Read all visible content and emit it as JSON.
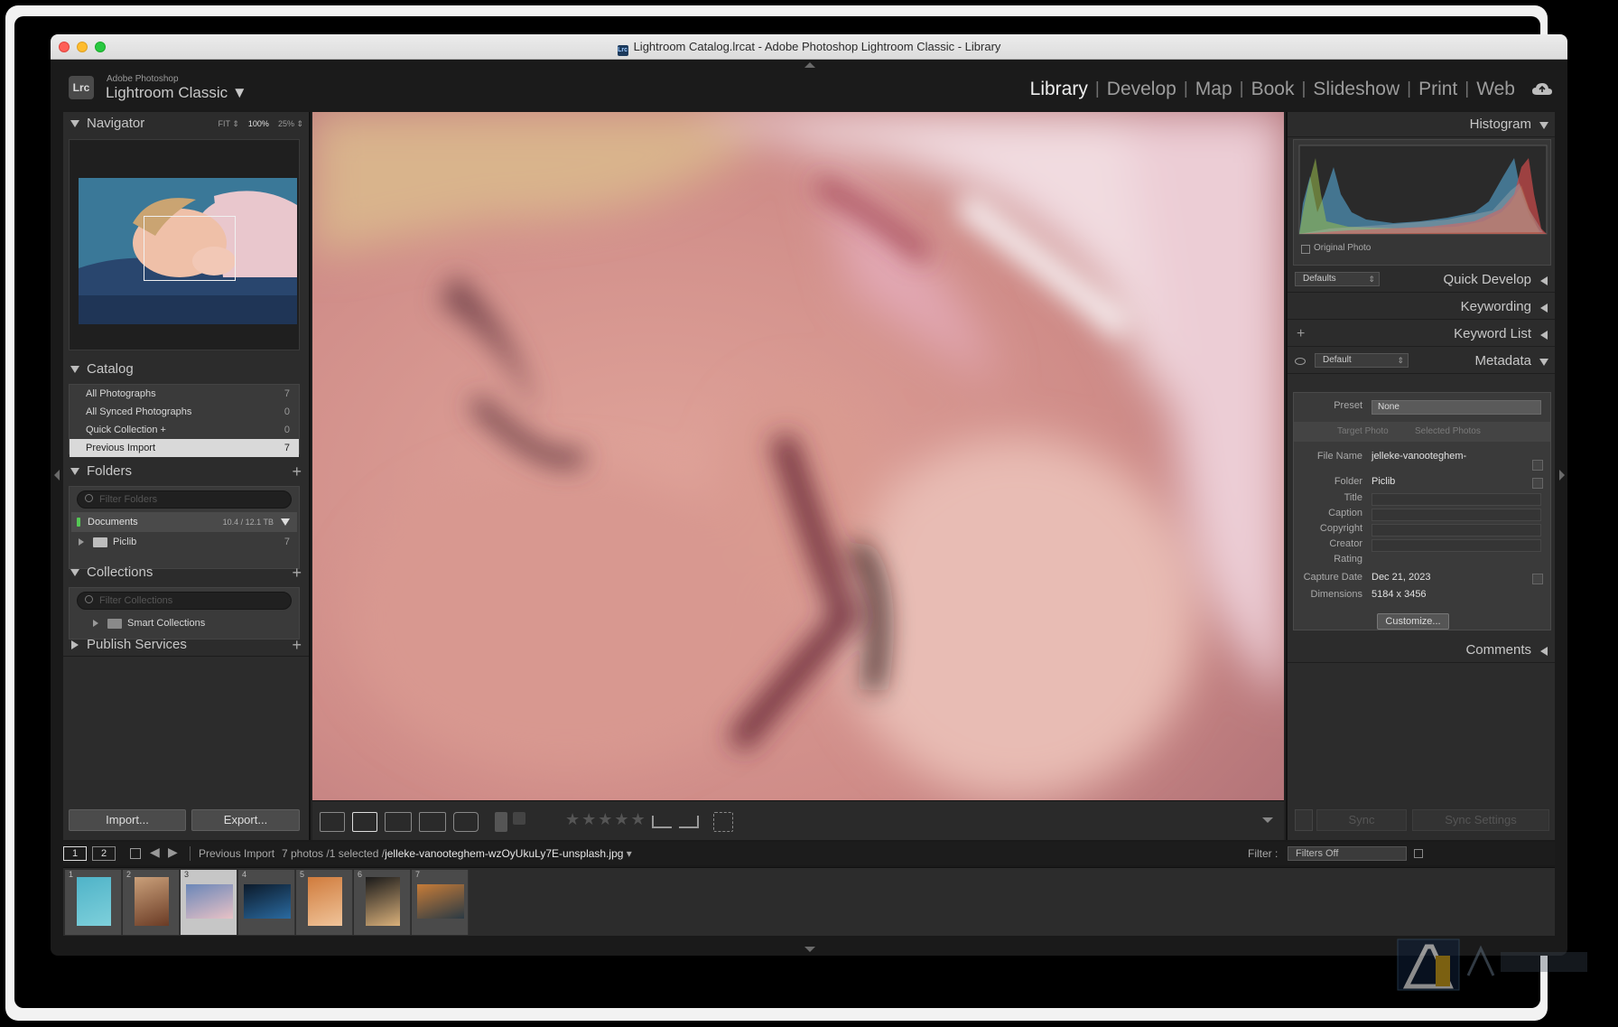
{
  "window": {
    "title": "Lightroom Catalog.lrcat - Adobe Photoshop Lightroom Classic - Library",
    "title_icon": "Lrc"
  },
  "identity": {
    "logo": "Lrc",
    "vendor": "Adobe Photoshop",
    "product": "Lightroom Classic ▼"
  },
  "modules": [
    "Library",
    "Develop",
    "Map",
    "Book",
    "Slideshow",
    "Print",
    "Web"
  ],
  "active_module": "Library",
  "left_panel": {
    "navigator": {
      "title": "Navigator",
      "options": [
        "FIT ⇕",
        "100%",
        "25% ⇕"
      ]
    },
    "catalog": {
      "title": "Catalog",
      "items": [
        {
          "label": "All Photographs",
          "count": "7"
        },
        {
          "label": "All Synced Photographs",
          "count": "0"
        },
        {
          "label": "Quick Collection +",
          "count": "0"
        },
        {
          "label": "Previous Import",
          "count": "7"
        }
      ]
    },
    "folders": {
      "title": "Folders",
      "plus": "+",
      "filter_placeholder": "Filter Folders",
      "volume": {
        "label": "Documents",
        "size": "10.4 / 12.1 TB"
      },
      "items": [
        {
          "label": "Piclib",
          "count": "7"
        }
      ]
    },
    "collections": {
      "title": "Collections",
      "plus": "+",
      "filter_placeholder": "Filter Collections",
      "items": [
        {
          "label": "Smart Collections"
        }
      ]
    },
    "publish_services": {
      "title": "Publish Services",
      "plus": "+"
    },
    "import_label": "Import...",
    "export_label": "Export..."
  },
  "right_panel": {
    "histogram": {
      "title": "Histogram",
      "original_photo_label": "Original Photo"
    },
    "quick_develop": {
      "title": "Quick Develop",
      "preset": "Defaults"
    },
    "keywording": {
      "title": "Keywording"
    },
    "keyword_list": {
      "title": "Keyword List",
      "plus": "+"
    },
    "metadata": {
      "title": "Metadata",
      "preset_select": "Default",
      "preset_label": "Preset",
      "preset_value": "None",
      "target_photo": "Target Photo",
      "selected_photos": "Selected Photos",
      "fields": {
        "file_name_label": "File Name",
        "file_name": "jelleke-vanooteghem-",
        "folder_label": "Folder",
        "folder": "Piclib",
        "title_label": "Title",
        "caption_label": "Caption",
        "copyright_label": "Copyright",
        "creator_label": "Creator",
        "rating_label": "Rating",
        "capture_date_label": "Capture Date",
        "capture_date": "Dec 21, 2023",
        "dimensions_label": "Dimensions",
        "dimensions": "5184 x 3456"
      },
      "customize_label": "Customize..."
    },
    "comments": {
      "title": "Comments"
    },
    "sync_label": "Sync",
    "sync_settings_label": "Sync Settings"
  },
  "toolbar": {
    "rating_stars": "★★★★★"
  },
  "filmstrip_bar": {
    "screen1": "1",
    "screen2": "2",
    "source": "Previous Import",
    "info": "7 photos /1 selected /",
    "filename": "jelleke-vanooteghem-wzOyUkuLy7E-unsplash.jpg",
    "filter_label": "Filter :",
    "filter_value": "Filters Off"
  },
  "filmstrip": [
    {
      "index": "1"
    },
    {
      "index": "2"
    },
    {
      "index": "3",
      "selected": true
    },
    {
      "index": "4"
    },
    {
      "index": "5"
    },
    {
      "index": "6"
    },
    {
      "index": "7"
    }
  ],
  "colors": {
    "accent_selected": "#d9d9d9",
    "panel": "#2c2c2c",
    "background": "#1a1a1a"
  }
}
